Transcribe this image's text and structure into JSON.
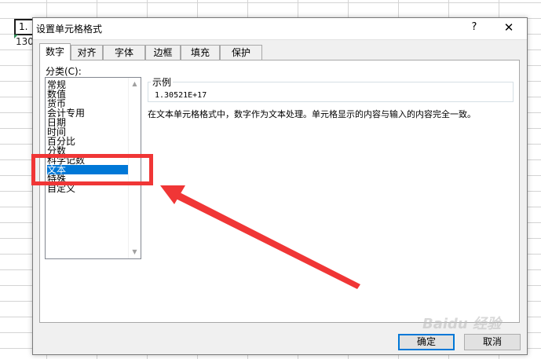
{
  "sheet": {
    "cell_a1": "1.",
    "cell_a2": "130"
  },
  "dialog": {
    "title": "设置单元格格式",
    "help_glyph": "?",
    "close_glyph": "✕",
    "tabs": [
      {
        "label": "数字",
        "active": true
      },
      {
        "label": "对齐",
        "active": false
      },
      {
        "label": "字体",
        "active": false
      },
      {
        "label": "边框",
        "active": false
      },
      {
        "label": "填充",
        "active": false
      },
      {
        "label": "保护",
        "active": false
      }
    ],
    "category_label": "分类(C):",
    "categories": [
      {
        "label": "常规",
        "selected": false
      },
      {
        "label": "数值",
        "selected": false
      },
      {
        "label": "货币",
        "selected": false
      },
      {
        "label": "会计专用",
        "selected": false
      },
      {
        "label": "日期",
        "selected": false
      },
      {
        "label": "时间",
        "selected": false
      },
      {
        "label": "百分比",
        "selected": false
      },
      {
        "label": "分数",
        "selected": false
      },
      {
        "label": "科学记数",
        "selected": false
      },
      {
        "label": "文本",
        "selected": true
      },
      {
        "label": "特殊",
        "selected": false
      },
      {
        "label": "自定义",
        "selected": false
      }
    ],
    "sample_label": "示例",
    "sample_value": "1.30521E+17",
    "description": "在文本单元格格式中，数字作为文本处理。单元格显示的内容与输入的内容完全一致。",
    "ok_label": "确定",
    "cancel_label": "取消"
  },
  "watermark": "Baidu 经验",
  "colors": {
    "selection": "#0078d7",
    "annotation": "#f03636"
  }
}
